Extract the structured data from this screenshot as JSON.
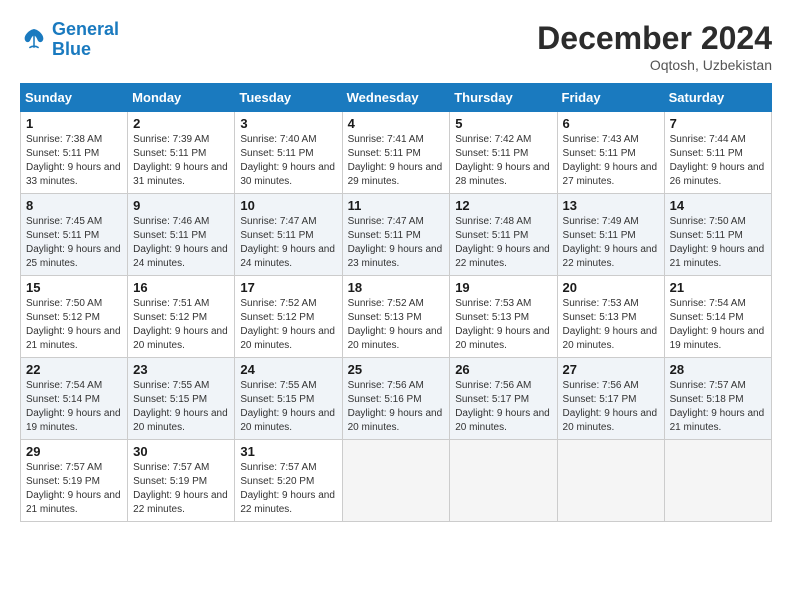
{
  "header": {
    "logo_line1": "General",
    "logo_line2": "Blue",
    "month_title": "December 2024",
    "subtitle": "Oqtosh, Uzbekistan"
  },
  "weekdays": [
    "Sunday",
    "Monday",
    "Tuesday",
    "Wednesday",
    "Thursday",
    "Friday",
    "Saturday"
  ],
  "weeks": [
    [
      {
        "day": "1",
        "sunrise": "Sunrise: 7:38 AM",
        "sunset": "Sunset: 5:11 PM",
        "daylight": "Daylight: 9 hours and 33 minutes."
      },
      {
        "day": "2",
        "sunrise": "Sunrise: 7:39 AM",
        "sunset": "Sunset: 5:11 PM",
        "daylight": "Daylight: 9 hours and 31 minutes."
      },
      {
        "day": "3",
        "sunrise": "Sunrise: 7:40 AM",
        "sunset": "Sunset: 5:11 PM",
        "daylight": "Daylight: 9 hours and 30 minutes."
      },
      {
        "day": "4",
        "sunrise": "Sunrise: 7:41 AM",
        "sunset": "Sunset: 5:11 PM",
        "daylight": "Daylight: 9 hours and 29 minutes."
      },
      {
        "day": "5",
        "sunrise": "Sunrise: 7:42 AM",
        "sunset": "Sunset: 5:11 PM",
        "daylight": "Daylight: 9 hours and 28 minutes."
      },
      {
        "day": "6",
        "sunrise": "Sunrise: 7:43 AM",
        "sunset": "Sunset: 5:11 PM",
        "daylight": "Daylight: 9 hours and 27 minutes."
      },
      {
        "day": "7",
        "sunrise": "Sunrise: 7:44 AM",
        "sunset": "Sunset: 5:11 PM",
        "daylight": "Daylight: 9 hours and 26 minutes."
      }
    ],
    [
      {
        "day": "8",
        "sunrise": "Sunrise: 7:45 AM",
        "sunset": "Sunset: 5:11 PM",
        "daylight": "Daylight: 9 hours and 25 minutes."
      },
      {
        "day": "9",
        "sunrise": "Sunrise: 7:46 AM",
        "sunset": "Sunset: 5:11 PM",
        "daylight": "Daylight: 9 hours and 24 minutes."
      },
      {
        "day": "10",
        "sunrise": "Sunrise: 7:47 AM",
        "sunset": "Sunset: 5:11 PM",
        "daylight": "Daylight: 9 hours and 24 minutes."
      },
      {
        "day": "11",
        "sunrise": "Sunrise: 7:47 AM",
        "sunset": "Sunset: 5:11 PM",
        "daylight": "Daylight: 9 hours and 23 minutes."
      },
      {
        "day": "12",
        "sunrise": "Sunrise: 7:48 AM",
        "sunset": "Sunset: 5:11 PM",
        "daylight": "Daylight: 9 hours and 22 minutes."
      },
      {
        "day": "13",
        "sunrise": "Sunrise: 7:49 AM",
        "sunset": "Sunset: 5:11 PM",
        "daylight": "Daylight: 9 hours and 22 minutes."
      },
      {
        "day": "14",
        "sunrise": "Sunrise: 7:50 AM",
        "sunset": "Sunset: 5:11 PM",
        "daylight": "Daylight: 9 hours and 21 minutes."
      }
    ],
    [
      {
        "day": "15",
        "sunrise": "Sunrise: 7:50 AM",
        "sunset": "Sunset: 5:12 PM",
        "daylight": "Daylight: 9 hours and 21 minutes."
      },
      {
        "day": "16",
        "sunrise": "Sunrise: 7:51 AM",
        "sunset": "Sunset: 5:12 PM",
        "daylight": "Daylight: 9 hours and 20 minutes."
      },
      {
        "day": "17",
        "sunrise": "Sunrise: 7:52 AM",
        "sunset": "Sunset: 5:12 PM",
        "daylight": "Daylight: 9 hours and 20 minutes."
      },
      {
        "day": "18",
        "sunrise": "Sunrise: 7:52 AM",
        "sunset": "Sunset: 5:13 PM",
        "daylight": "Daylight: 9 hours and 20 minutes."
      },
      {
        "day": "19",
        "sunrise": "Sunrise: 7:53 AM",
        "sunset": "Sunset: 5:13 PM",
        "daylight": "Daylight: 9 hours and 20 minutes."
      },
      {
        "day": "20",
        "sunrise": "Sunrise: 7:53 AM",
        "sunset": "Sunset: 5:13 PM",
        "daylight": "Daylight: 9 hours and 20 minutes."
      },
      {
        "day": "21",
        "sunrise": "Sunrise: 7:54 AM",
        "sunset": "Sunset: 5:14 PM",
        "daylight": "Daylight: 9 hours and 19 minutes."
      }
    ],
    [
      {
        "day": "22",
        "sunrise": "Sunrise: 7:54 AM",
        "sunset": "Sunset: 5:14 PM",
        "daylight": "Daylight: 9 hours and 19 minutes."
      },
      {
        "day": "23",
        "sunrise": "Sunrise: 7:55 AM",
        "sunset": "Sunset: 5:15 PM",
        "daylight": "Daylight: 9 hours and 20 minutes."
      },
      {
        "day": "24",
        "sunrise": "Sunrise: 7:55 AM",
        "sunset": "Sunset: 5:15 PM",
        "daylight": "Daylight: 9 hours and 20 minutes."
      },
      {
        "day": "25",
        "sunrise": "Sunrise: 7:56 AM",
        "sunset": "Sunset: 5:16 PM",
        "daylight": "Daylight: 9 hours and 20 minutes."
      },
      {
        "day": "26",
        "sunrise": "Sunrise: 7:56 AM",
        "sunset": "Sunset: 5:17 PM",
        "daylight": "Daylight: 9 hours and 20 minutes."
      },
      {
        "day": "27",
        "sunrise": "Sunrise: 7:56 AM",
        "sunset": "Sunset: 5:17 PM",
        "daylight": "Daylight: 9 hours and 20 minutes."
      },
      {
        "day": "28",
        "sunrise": "Sunrise: 7:57 AM",
        "sunset": "Sunset: 5:18 PM",
        "daylight": "Daylight: 9 hours and 21 minutes."
      }
    ],
    [
      {
        "day": "29",
        "sunrise": "Sunrise: 7:57 AM",
        "sunset": "Sunset: 5:19 PM",
        "daylight": "Daylight: 9 hours and 21 minutes."
      },
      {
        "day": "30",
        "sunrise": "Sunrise: 7:57 AM",
        "sunset": "Sunset: 5:19 PM",
        "daylight": "Daylight: 9 hours and 22 minutes."
      },
      {
        "day": "31",
        "sunrise": "Sunrise: 7:57 AM",
        "sunset": "Sunset: 5:20 PM",
        "daylight": "Daylight: 9 hours and 22 minutes."
      },
      null,
      null,
      null,
      null
    ]
  ]
}
